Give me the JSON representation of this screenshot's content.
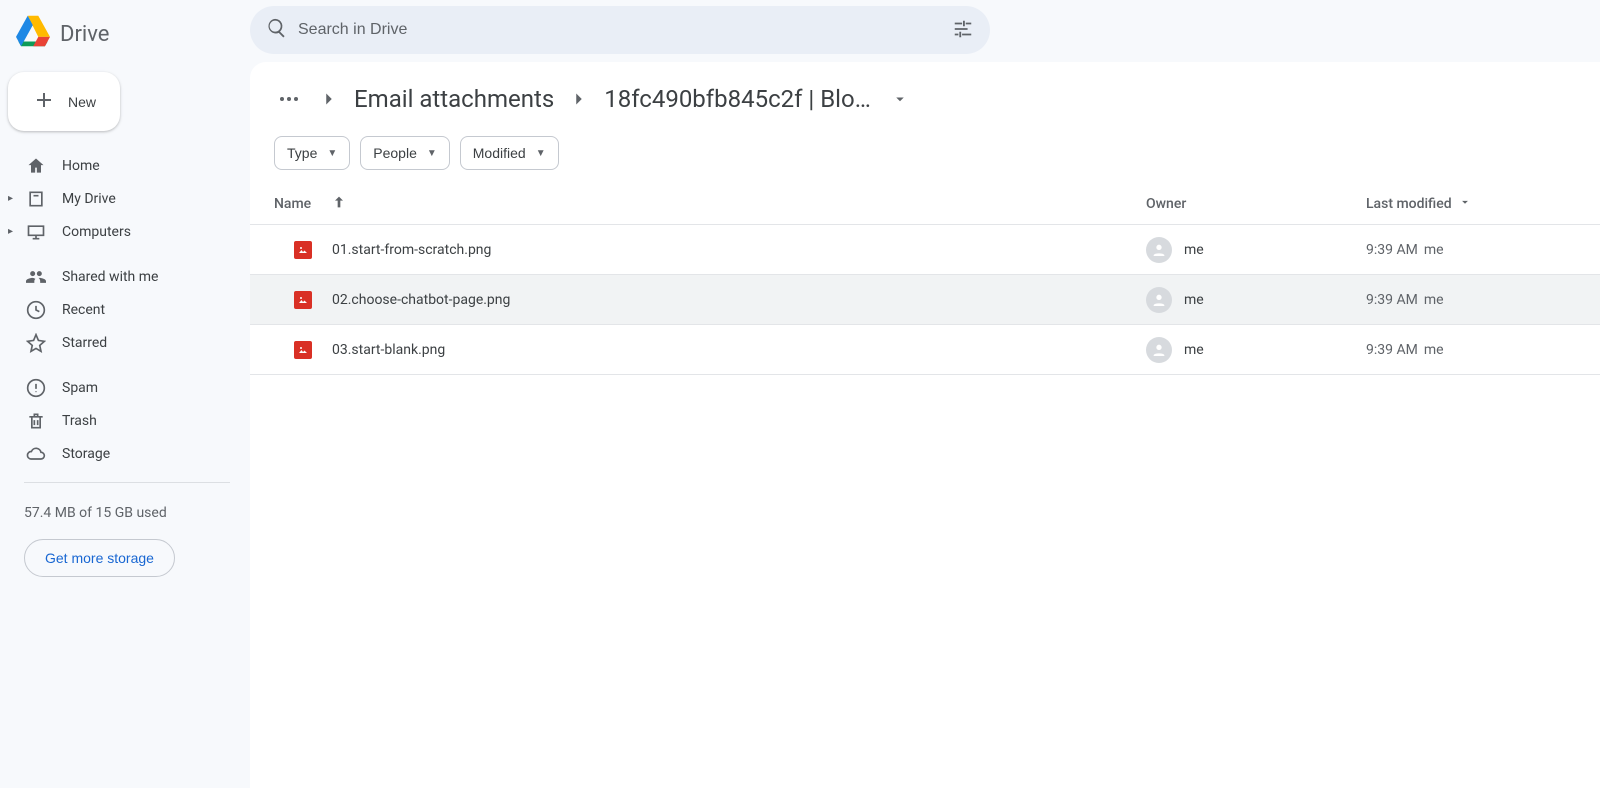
{
  "brand": {
    "name": "Drive"
  },
  "sidebar": {
    "new_label": "New",
    "items": [
      {
        "label": "Home"
      },
      {
        "label": "My Drive"
      },
      {
        "label": "Computers"
      }
    ],
    "items2": [
      {
        "label": "Shared with me"
      },
      {
        "label": "Recent"
      },
      {
        "label": "Starred"
      }
    ],
    "items3": [
      {
        "label": "Spam"
      },
      {
        "label": "Trash"
      },
      {
        "label": "Storage"
      }
    ],
    "storage_used": "57.4 MB of 15 GB used",
    "storage_cta": "Get more storage"
  },
  "search": {
    "placeholder": "Search in Drive"
  },
  "breadcrumb": {
    "seg1": "Email attachments",
    "seg2": "18fc490bfb845c2f | Blo…"
  },
  "filters": {
    "type": "Type",
    "people": "People",
    "modified": "Modified"
  },
  "columns": {
    "name": "Name",
    "owner": "Owner",
    "modified": "Last modified"
  },
  "rows": [
    {
      "name": "01.start-from-scratch.png",
      "owner": "me",
      "time": "9:39 AM",
      "by": "me",
      "hover": false
    },
    {
      "name": "02.choose-chatbot-page.png",
      "owner": "me",
      "time": "9:39 AM",
      "by": "me",
      "hover": true
    },
    {
      "name": "03.start-blank.png",
      "owner": "me",
      "time": "9:39 AM",
      "by": "me",
      "hover": false
    }
  ]
}
